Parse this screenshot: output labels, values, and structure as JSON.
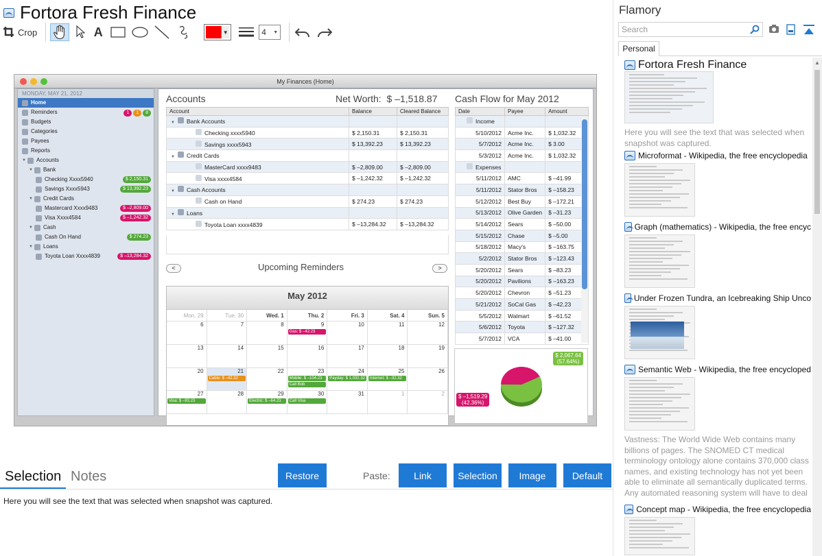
{
  "app": {
    "title": "Fortora Fresh Finance",
    "crop_label": "Crop",
    "line_width_value": "4"
  },
  "screenshot": {
    "window_title": "My Finances (Home)",
    "sidebar": {
      "date": "MONDAY, MAY 21, 2012",
      "items": [
        {
          "label": "Home",
          "indent": 0,
          "selected": true
        },
        {
          "label": "Reminders",
          "indent": 0,
          "badges": [
            {
              "text": "1",
              "color": "#d6156b"
            },
            {
              "text": "1",
              "color": "#e8901a"
            },
            {
              "text": "8",
              "color": "#53a83a"
            }
          ]
        },
        {
          "label": "Budgets",
          "indent": 0
        },
        {
          "label": "Categories",
          "indent": 0
        },
        {
          "label": "Payees",
          "indent": 0
        },
        {
          "label": "Reports",
          "indent": 0
        },
        {
          "label": "Accounts",
          "indent": 0
        },
        {
          "label": "Bank",
          "indent": 1
        },
        {
          "label": "Checking Xxxx5940",
          "indent": 2,
          "amount": "$ 2,150.31",
          "color": "#53a83a"
        },
        {
          "label": "Savings Xxxx5943",
          "indent": 2,
          "amount": "$ 13,392.23",
          "color": "#53a83a"
        },
        {
          "label": "Credit Cards",
          "indent": 1
        },
        {
          "label": "Mastercard Xxxx9483",
          "indent": 2,
          "amount": "$ –2,809.00",
          "color": "#d6156b"
        },
        {
          "label": "Visa Xxxx4584",
          "indent": 2,
          "amount": "$ –1,242.32",
          "color": "#d6156b"
        },
        {
          "label": "Cash",
          "indent": 1
        },
        {
          "label": "Cash On Hand",
          "indent": 2,
          "amount": "$ 274.23",
          "color": "#53a83a"
        },
        {
          "label": "Loans",
          "indent": 1
        },
        {
          "label": "Toyota Loan Xxxx4839",
          "indent": 2,
          "amount": "$ –13,284.32",
          "color": "#d6156b"
        }
      ]
    },
    "accounts": {
      "title": "Accounts",
      "net_worth_label": "Net Worth:",
      "net_worth_value": "$ –1,518.87",
      "columns": [
        "Account",
        "Balance",
        "Cleared Balance"
      ],
      "rows": [
        {
          "name": "Bank Accounts",
          "group": true,
          "balance": "",
          "cleared": ""
        },
        {
          "name": "Checking xxxx5940",
          "balance": "$ 2,150.31",
          "cleared": "$ 2,150.31"
        },
        {
          "name": "Savings xxxx5943",
          "balance": "$ 13,392.23",
          "cleared": "$ 13,392.23"
        },
        {
          "name": "Credit Cards",
          "group": true,
          "balance": "",
          "cleared": ""
        },
        {
          "name": "MasterCard xxxx9483",
          "balance": "$ –2,809.00",
          "cleared": "$ –2,809.00"
        },
        {
          "name": "Visa xxxx4584",
          "balance": "$ –1,242.32",
          "cleared": "$ –1,242.32"
        },
        {
          "name": "Cash Accounts",
          "group": true,
          "balance": "",
          "cleared": ""
        },
        {
          "name": "Cash on Hand",
          "balance": "$ 274.23",
          "cleared": "$ 274.23"
        },
        {
          "name": "Loans",
          "group": true,
          "balance": "",
          "cleared": ""
        },
        {
          "name": "Toyota Loan xxxx4839",
          "balance": "$ –13,284.32",
          "cleared": "$ –13,284.32"
        }
      ]
    },
    "cashflow": {
      "title": "Cash Flow for May 2012",
      "columns": [
        "Date",
        "Payee",
        "Amount"
      ],
      "rows": [
        {
          "date": "Income",
          "payee": "",
          "amount": "",
          "group": true
        },
        {
          "date": "5/10/2012",
          "payee": "Acme Inc.",
          "amount": "$ 1,032.32"
        },
        {
          "date": "5/7/2012",
          "payee": "Acme Inc.",
          "amount": "$ 3.00"
        },
        {
          "date": "5/3/2012",
          "payee": "Acme Inc.",
          "amount": "$ 1,032.32"
        },
        {
          "date": "Expenses",
          "payee": "",
          "amount": "",
          "group": true
        },
        {
          "date": "5/11/2012",
          "payee": "AMC",
          "amount": "$ –41.99"
        },
        {
          "date": "5/11/2012",
          "payee": "Stator Bros",
          "amount": "$ –158.23"
        },
        {
          "date": "5/12/2012",
          "payee": "Best Buy",
          "amount": "$ –172.21"
        },
        {
          "date": "5/13/2012",
          "payee": "Olive Garden",
          "amount": "$ –31.23"
        },
        {
          "date": "5/14/2012",
          "payee": "Sears",
          "amount": "$ –50.00"
        },
        {
          "date": "5/15/2012",
          "payee": "Chase",
          "amount": "$ –5.00"
        },
        {
          "date": "5/18/2012",
          "payee": "Macy's",
          "amount": "$ –163.75"
        },
        {
          "date": "5/2/2012",
          "payee": "Stator Bros",
          "amount": "$ –123.43"
        },
        {
          "date": "5/20/2012",
          "payee": "Sears",
          "amount": "$ –83.23"
        },
        {
          "date": "5/20/2012",
          "payee": "Pavilions",
          "amount": "$ –163.23"
        },
        {
          "date": "5/20/2012",
          "payee": "Chevron",
          "amount": "$ –51.23"
        },
        {
          "date": "5/21/2012",
          "payee": "SoCal Gas",
          "amount": "$ –42.23"
        },
        {
          "date": "5/5/2012",
          "payee": "Walmart",
          "amount": "$ –61.52"
        },
        {
          "date": "5/6/2012",
          "payee": "Toyota",
          "amount": "$ –127.32"
        },
        {
          "date": "5/7/2012",
          "payee": "VCA",
          "amount": "$ –41.00"
        }
      ],
      "pie": {
        "positive_amount": "$ 2,067.64",
        "positive_pct": "(57.64%)",
        "positive_value": 57.64,
        "positive_color": "#7ac142",
        "negative_amount": "$ –1,519.29",
        "negative_pct": "(42.36%)",
        "negative_value": 42.36,
        "negative_color": "#d6156b"
      }
    },
    "calendar": {
      "reminders_title": "Upcoming Reminders",
      "prev_icon": "<",
      "next_icon": ">",
      "month": "May 2012",
      "weekdays": [
        {
          "d": "Mon. 29",
          "gray": true
        },
        {
          "d": "Tue. 30",
          "gray": true
        },
        {
          "d": "Wed. 1"
        },
        {
          "d": "Thu. 2"
        },
        {
          "d": "Fri. 3"
        },
        {
          "d": "Sat. 4"
        },
        {
          "d": "Sun. 5"
        }
      ],
      "cells": [
        {
          "n": "6"
        },
        {
          "n": "7"
        },
        {
          "n": "8"
        },
        {
          "n": "9",
          "events": [
            {
              "t": "Gas: $ –42.23",
              "c": "#d6156b"
            }
          ]
        },
        {
          "n": "10"
        },
        {
          "n": "11"
        },
        {
          "n": "12"
        },
        {
          "n": "13"
        },
        {
          "n": "14"
        },
        {
          "n": "15"
        },
        {
          "n": "16"
        },
        {
          "n": "17"
        },
        {
          "n": "18"
        },
        {
          "n": "19"
        },
        {
          "n": "20"
        },
        {
          "n": "21",
          "today": true,
          "events": [
            {
              "t": "Cable: $ –42.32",
              "c": "#e8901a"
            }
          ]
        },
        {
          "n": "22"
        },
        {
          "n": "23",
          "events": [
            {
              "t": "Mobile: $ –104.23",
              "c": "#53a83a"
            },
            {
              "t": "Call Bob",
              "c": "#53a83a"
            }
          ]
        },
        {
          "n": "24",
          "events": [
            {
              "t": "Payday: $ 1,032.32",
              "c": "#53a83a"
            }
          ]
        },
        {
          "n": "25",
          "events": [
            {
              "t": "Internet: $ –32.32",
              "c": "#53a83a"
            }
          ]
        },
        {
          "n": "26"
        },
        {
          "n": "27",
          "events": [
            {
              "t": "Visa: $ –93.23",
              "c": "#53a83a"
            }
          ]
        },
        {
          "n": "28"
        },
        {
          "n": "29",
          "events": [
            {
              "t": "Electric: $ –64.23",
              "c": "#53a83a"
            }
          ]
        },
        {
          "n": "30",
          "events": [
            {
              "t": "Call Visa",
              "c": "#53a83a"
            }
          ]
        },
        {
          "n": "31"
        },
        {
          "n": "1",
          "gray": true
        },
        {
          "n": "2",
          "gray": true
        }
      ]
    }
  },
  "bottom": {
    "tab_selection": "Selection",
    "tab_notes": "Notes",
    "restore_label": "Restore",
    "paste_label": "Paste:",
    "link_label": "Link",
    "selection_label": "Selection",
    "image_label": "Image",
    "default_label": "Default",
    "selection_text": "Here you will see the text that was selected when snapshot was captured."
  },
  "flamory": {
    "title": "Flamory",
    "search_placeholder": "Search",
    "tab_personal": "Personal",
    "items": [
      {
        "title": "Fortora Fresh Finance",
        "desc": "Here you will see the text that was selected when snapshot was captured."
      },
      {
        "title": "Microformat - Wikipedia, the free encyclopedia"
      },
      {
        "title": "Graph (mathematics) - Wikipedia, the free encyc"
      },
      {
        "title": "Under Frozen Tundra, an Icebreaking Ship Unco"
      },
      {
        "title": "Semantic Web - Wikipedia, the free encycloped",
        "desc": "Vastness: The World Wide Web contains many billions of pages. The SNOMED CT medical terminology ontology alone contains 370,000 class names, and existing technology has not yet been able to eliminate all semantically duplicated terms. Any automated reasoning system will have to deal with truly huge inputs."
      },
      {
        "title": "Concept map - Wikipedia, the free encyclopedia"
      }
    ]
  }
}
